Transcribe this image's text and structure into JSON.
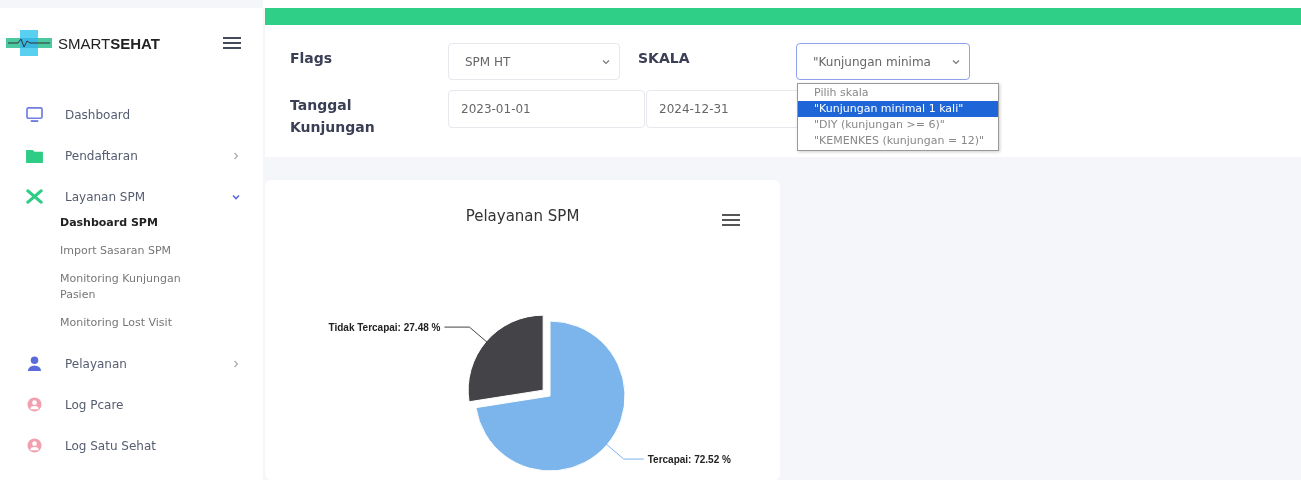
{
  "brand": {
    "name_light": "SMART",
    "name_bold": "SEHAT"
  },
  "sidebar": {
    "items": [
      {
        "label": "Dashboard"
      },
      {
        "label": "Pendaftaran",
        "expanded": false
      },
      {
        "label": "Layanan SPM",
        "expanded": true,
        "children": [
          {
            "label": "Dashboard SPM",
            "selected": true
          },
          {
            "label": "Import Sasaran SPM",
            "selected": false
          },
          {
            "label": "Monitoring Kunjungan Pasien",
            "selected": false
          },
          {
            "label": "Monitoring Lost Visit",
            "selected": false
          }
        ]
      },
      {
        "label": "Pelayanan",
        "expanded": false
      },
      {
        "label": "Log Pcare"
      },
      {
        "label": "Log Satu Sehat"
      }
    ]
  },
  "filters": {
    "flags_label": "Flags",
    "flags_value": "SPM HT",
    "skala_label": "SKALA",
    "skala_value": "\"Kunjungan minima",
    "skala_open": true,
    "skala_options": [
      {
        "label": "Pilih skala",
        "selected": false
      },
      {
        "label": "\"Kunjungan minimal 1 kali\"",
        "selected": true
      },
      {
        "label": "\"DIY (kunjungan >= 6)\"",
        "selected": false
      },
      {
        "label": "\"KEMENKES (kunjungan = 12)\"",
        "selected": false
      }
    ],
    "date_label": "Tanggal Kunjungan",
    "date_from": "2023-01-01",
    "date_to": "2024-12-31"
  },
  "chart": {
    "chart_data": {
      "type": "pie",
      "title": "Pelayanan SPM",
      "values": [
        72.52,
        27.48
      ],
      "colors": [
        "#7cb5ec",
        "#434348"
      ],
      "value_labels": [
        "Tercapai: 72.52 %",
        "Tidak Tercapai: 27.48 %"
      ]
    }
  }
}
